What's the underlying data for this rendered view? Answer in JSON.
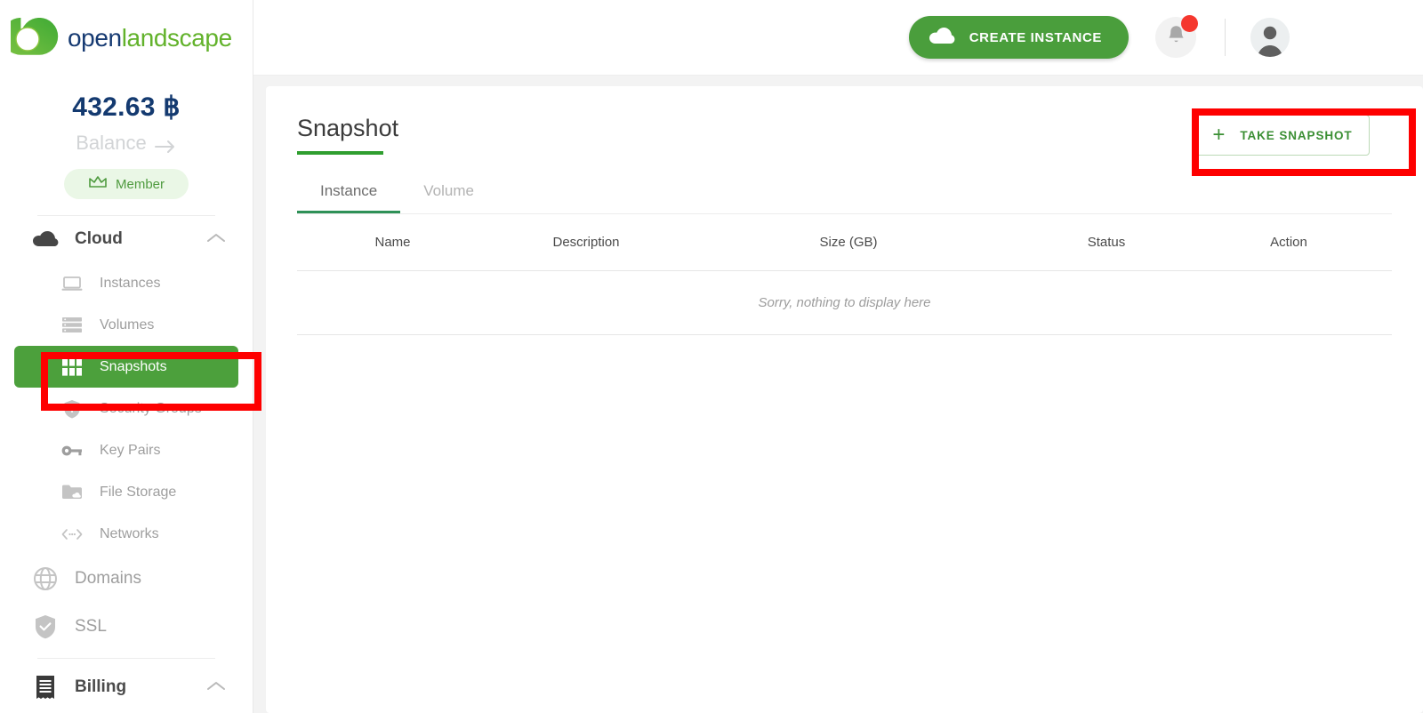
{
  "brand": {
    "logo_open": "open",
    "logo_landscape": "landscape",
    "logo_mark_icon": "leaf-drop-icon",
    "accent_green": "#4ca03c",
    "header_green": "#4a9e3c",
    "navy": "#143a70",
    "highlight_red": "#fe0000"
  },
  "sidebar": {
    "balance": {
      "amount": "432.63 ฿",
      "link_label": "Balance",
      "arrow_icon": "arrow-right-icon",
      "badge_label": "Member",
      "badge_icon": "crown-icon"
    },
    "groups": [
      {
        "label": "Cloud",
        "icon": "cloud-icon",
        "chevron_icon": "chevron-up-icon",
        "expanded": true,
        "items": [
          {
            "label": "Instances",
            "icon": "laptop-icon",
            "active": false
          },
          {
            "label": "Volumes",
            "icon": "server-stack-icon",
            "active": false
          },
          {
            "label": "Snapshots",
            "icon": "grid-icon",
            "active": true
          },
          {
            "label": "Security Groups",
            "icon": "shield-icon",
            "active": false
          },
          {
            "label": "Key Pairs",
            "icon": "key-icon",
            "active": false
          },
          {
            "label": "File Storage",
            "icon": "folder-cloud-icon",
            "active": false
          },
          {
            "label": "Networks",
            "icon": "network-icon",
            "active": false
          }
        ]
      }
    ],
    "top_links": [
      {
        "label": "Domains",
        "icon": "globe-icon"
      },
      {
        "label": "SSL",
        "icon": "shield-check-icon"
      }
    ],
    "billing": {
      "label": "Billing",
      "icon": "receipt-icon",
      "chevron_icon": "chevron-up-icon"
    }
  },
  "topbar": {
    "create_instance_label": "CREATE INSTANCE",
    "create_instance_icon": "cloud-icon",
    "bell_icon": "bell-icon",
    "has_notification": true,
    "avatar_icon": "user-avatar-icon"
  },
  "page": {
    "title": "Snapshot",
    "take_snapshot_label": "TAKE SNAPSHOT",
    "take_snapshot_icon": "plus-icon",
    "tabs": [
      {
        "label": "Instance",
        "active": true
      },
      {
        "label": "Volume",
        "active": false
      }
    ],
    "table": {
      "columns": [
        "Name",
        "Description",
        "Size (GB)",
        "Status",
        "Action"
      ],
      "rows": [],
      "empty_message": "Sorry, nothing to display here"
    }
  }
}
